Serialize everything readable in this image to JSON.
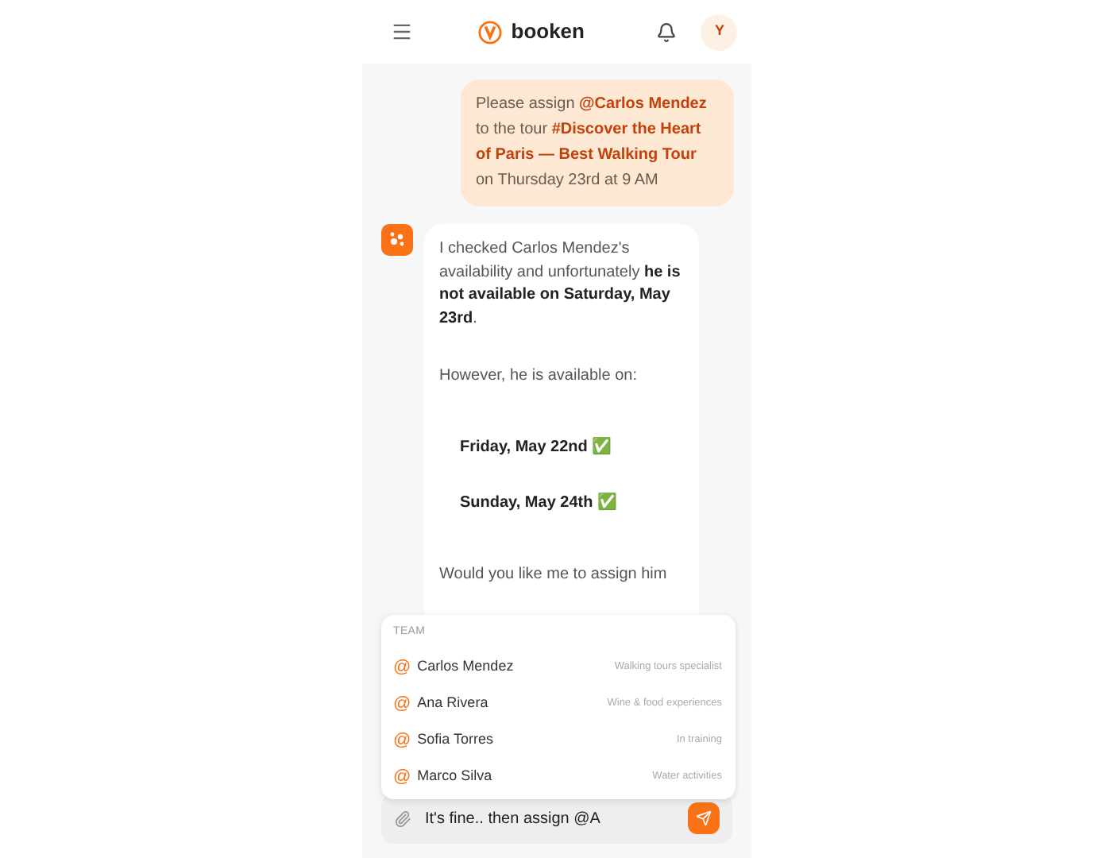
{
  "header": {
    "brand": "booken",
    "avatar": "Y"
  },
  "messages": [
    {
      "kind": "user",
      "text": "Please assign **@Carlos Mendez** to the tour **#Discover the Heart of Paris — Best Walking Tour** on Thursday 23rd at 9 AM"
    },
    {
      "kind": "bot",
      "paragraphs": [
        "I checked Carlos Mendez's availability and unfortunately **he is not available on Saturday, May 23rd**.",
        "However, he is available on:"
      ],
      "dates": [
        "Friday, May 22nd ✅",
        "Sunday, May 24th ✅"
      ],
      "closing": "Would you like me to assign him"
    }
  ],
  "mention_popup": {
    "heading": "TEAM",
    "items": [
      {
        "symbol": "@",
        "name": "Carlos Mendez",
        "role": "Walking tours specialist"
      },
      {
        "symbol": "@",
        "name": "Ana Rivera",
        "role": "Wine & food experiences"
      },
      {
        "symbol": "@",
        "name": "Sofia Torres",
        "role": "In training"
      },
      {
        "symbol": "@",
        "name": "Marco Silva",
        "role": "Water activities"
      }
    ]
  },
  "composer": {
    "value": "It's fine.. then assign @A"
  }
}
